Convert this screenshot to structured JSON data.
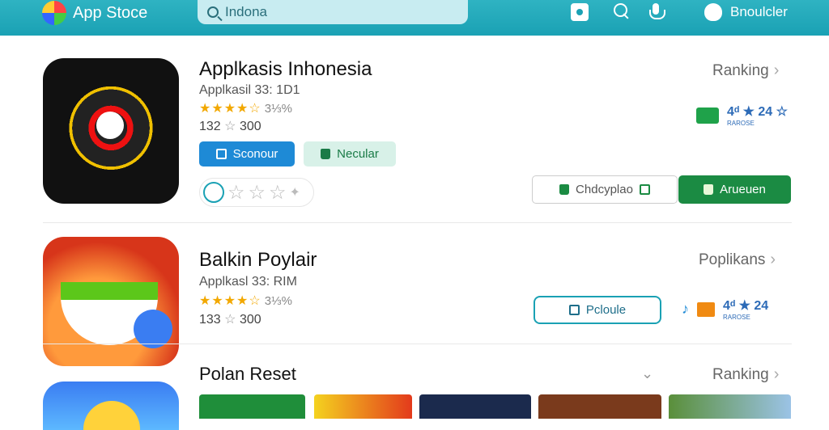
{
  "topbar": {
    "brand": "App Stoce",
    "search_value": "Indona",
    "user_label": "Bnoulcler"
  },
  "app1": {
    "title": "Applkasis Inhonesia",
    "sub": "Apрlkasil 33: 1D1",
    "stars": "★★★★☆",
    "pct": "3⅓%",
    "count": "132",
    "count_star": "☆",
    "count_value": "300",
    "btn_primary": "Sconour",
    "btn_secondary": "Necular",
    "btn_outline": "Chdcyplao",
    "btn_green": "Arueuen",
    "link": "Ranking",
    "rank": "4ᵈ ★ 24 ☆",
    "rank_small": "RAROSE"
  },
  "app2": {
    "title": "Balkin Poylair",
    "sub": "Applkasl 33: RIM",
    "stars": "★★★★☆",
    "pct": "3⅓%",
    "count": "133",
    "count_star": "☆",
    "count_value": "300",
    "btn_outline": "Pcloule",
    "link": "Poplikans",
    "rank": "4ᵈ ★ 24",
    "rank_small": "RAROSE"
  },
  "section": {
    "title": "Polan Reset",
    "link": "Ranking"
  },
  "colors": {
    "topbar": "#1aa1b4",
    "primary_blue": "#1e8ad6",
    "green": "#1b8b43",
    "star": "#f2a800"
  }
}
